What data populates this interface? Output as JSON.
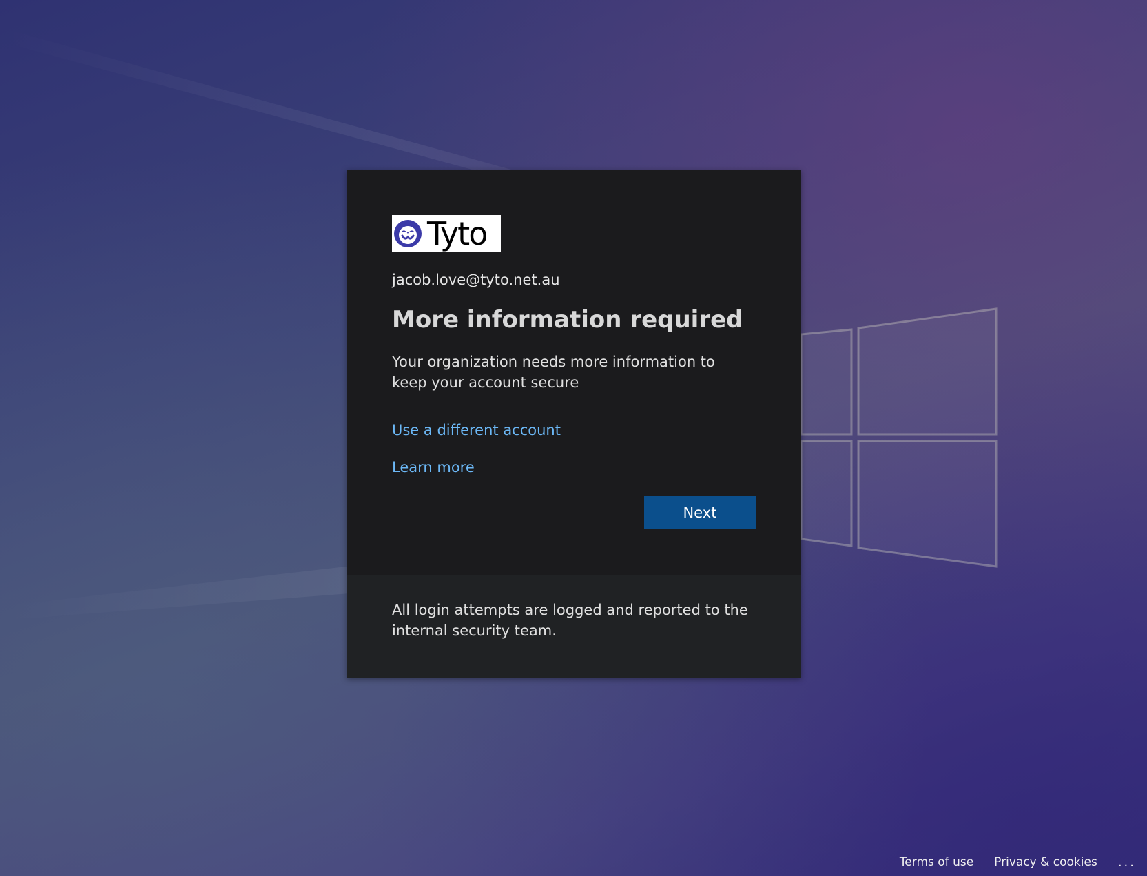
{
  "brand": {
    "logo_text": "Tyto",
    "logo_icon": "owl-face-icon",
    "logo_color": "#3b3aa8"
  },
  "account": {
    "email": "jacob.love@tyto.net.au"
  },
  "main": {
    "title": "More information required",
    "description": "Your organization needs more information to keep your account secure",
    "links": {
      "use_different_account": "Use a different account",
      "learn_more": "Learn more"
    },
    "next_button_label": "Next"
  },
  "notice": {
    "text": "All login attempts are logged and reported to the internal security team."
  },
  "footer": {
    "terms_label": "Terms of use",
    "privacy_label": "Privacy & cookies",
    "more_label": "..."
  },
  "colors": {
    "card_bg": "#1b1b1d",
    "footer_bg": "#202224",
    "link": "#6cb8f6",
    "button_bg": "#0b4f8c"
  }
}
